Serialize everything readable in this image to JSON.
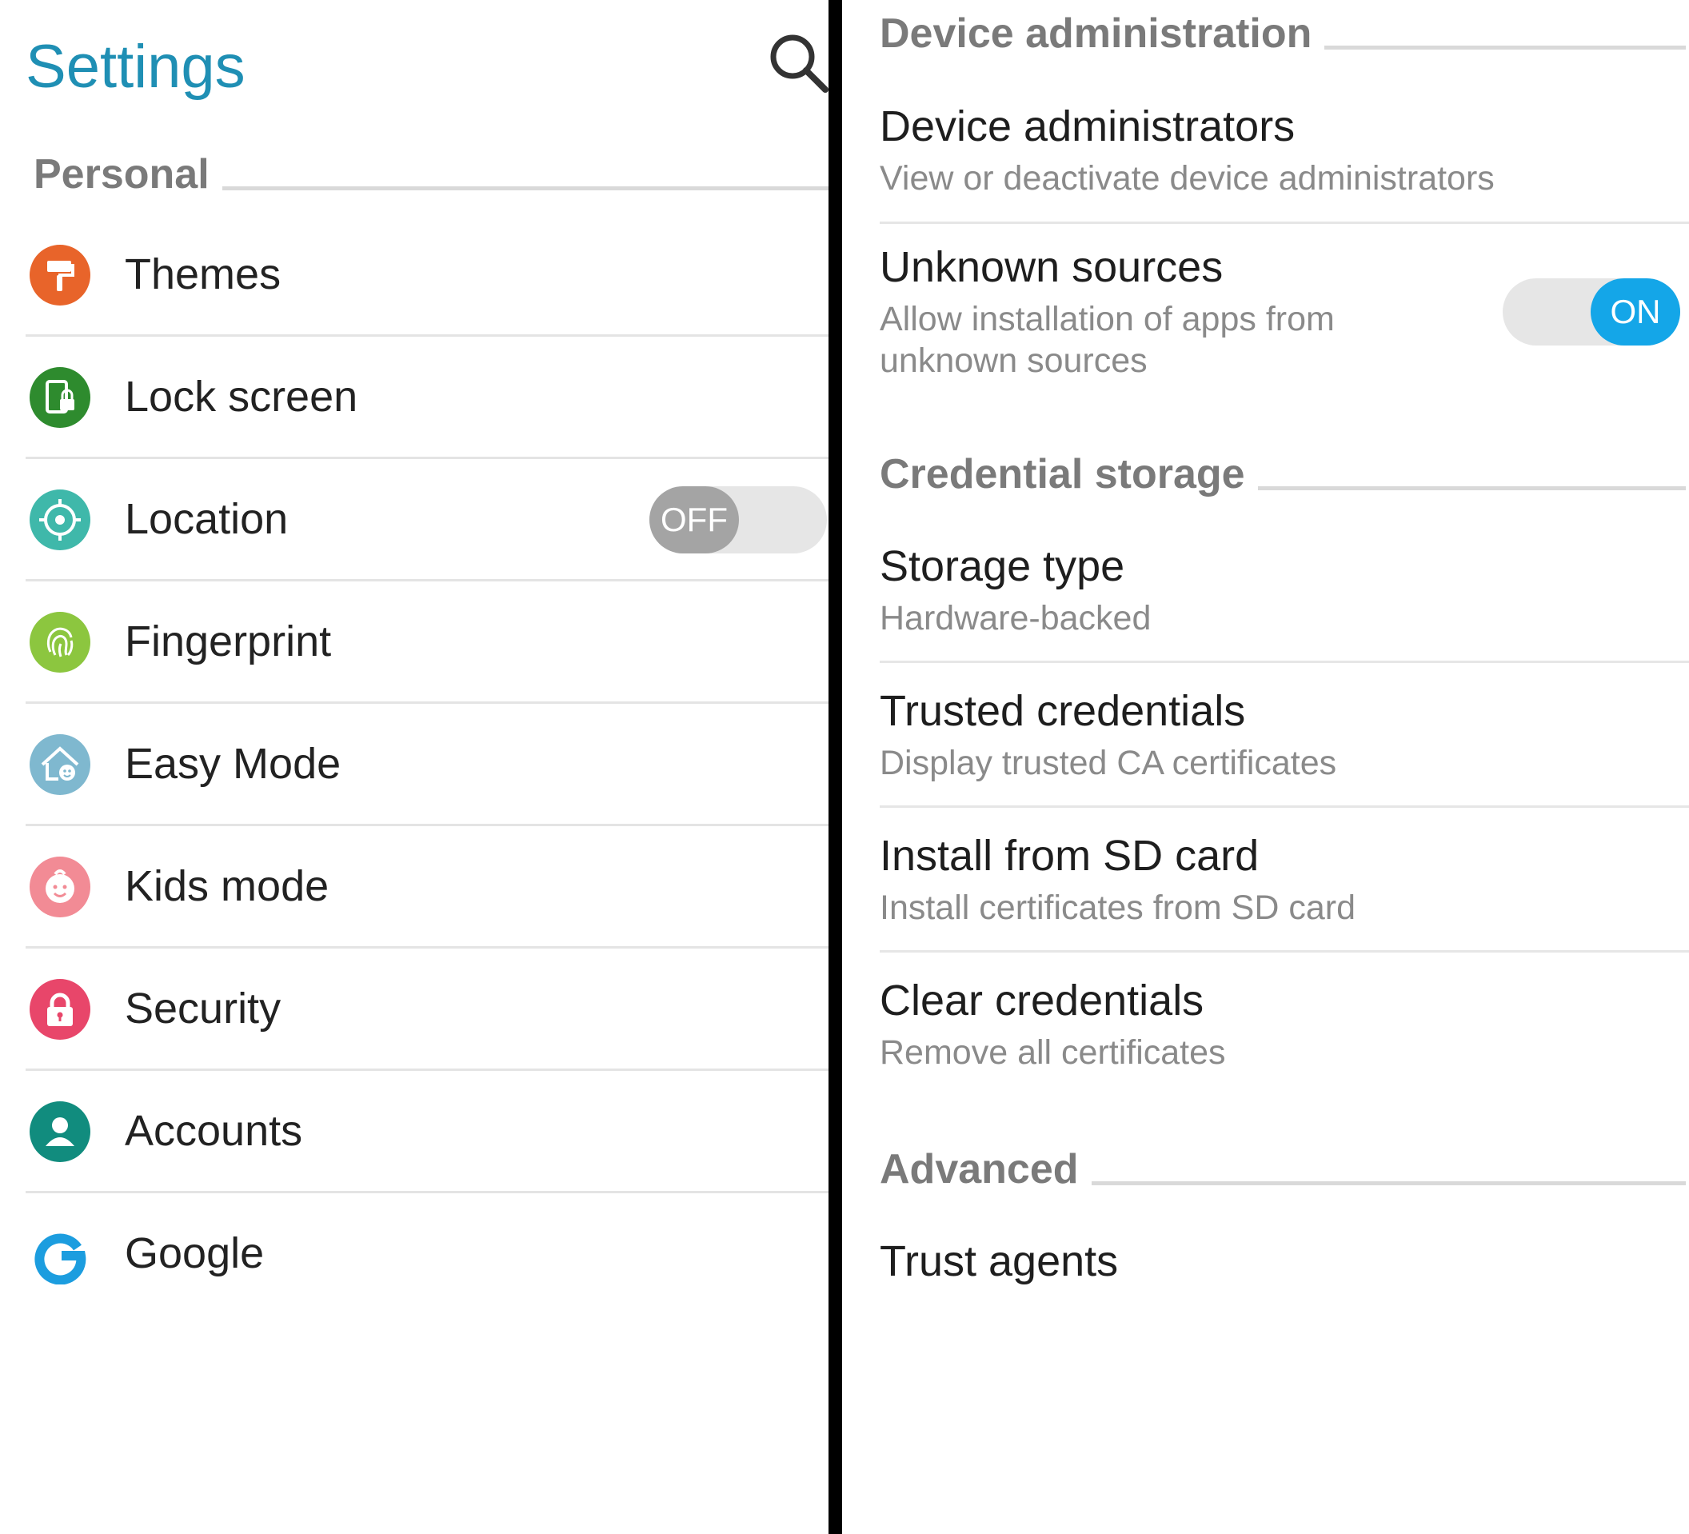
{
  "left": {
    "title": "Settings",
    "section": "Personal",
    "items": [
      {
        "label": "Themes",
        "icon": "paint-roller-icon",
        "color": "#e8642a"
      },
      {
        "label": "Lock screen",
        "icon": "lock-screen-icon",
        "color": "#2e8b2e"
      },
      {
        "label": "Location",
        "icon": "location-crosshair-icon",
        "color": "#3fb8aa",
        "toggle": "OFF"
      },
      {
        "label": "Fingerprint",
        "icon": "fingerprint-icon",
        "color": "#8cc63f"
      },
      {
        "label": "Easy Mode",
        "icon": "easy-mode-house-icon",
        "color": "#7fb8cf"
      },
      {
        "label": "Kids mode",
        "icon": "kid-face-icon",
        "color": "#f28b95"
      },
      {
        "label": "Security",
        "icon": "padlock-icon",
        "color": "#e8466a"
      },
      {
        "label": "Accounts",
        "icon": "person-icon",
        "color": "#118c7e"
      },
      {
        "label": "Google",
        "icon": "google-g-icon",
        "color": "#1c9ddf"
      }
    ]
  },
  "right": {
    "sections": [
      {
        "header": "Device administration",
        "items": [
          {
            "title": "Device administrators",
            "subtitle": "View or deactivate device administrators"
          },
          {
            "title": "Unknown sources",
            "subtitle_line1": "Allow installation of apps from",
            "subtitle_line2": "unknown sources",
            "toggle": "ON"
          }
        ]
      },
      {
        "header": "Credential storage",
        "items": [
          {
            "title": "Storage type",
            "subtitle": "Hardware-backed"
          },
          {
            "title": "Trusted credentials",
            "subtitle": "Display trusted CA certificates"
          },
          {
            "title": "Install from SD card",
            "subtitle": "Install certificates from SD card"
          },
          {
            "title": "Clear credentials",
            "subtitle": "Remove all certificates"
          }
        ]
      },
      {
        "header": "Advanced",
        "items": [
          {
            "title": "Trust agents"
          }
        ]
      }
    ]
  },
  "colors": {
    "accent": "#1f8fb4",
    "toggle_on": "#14a6e8",
    "toggle_off": "#a4a4a4"
  }
}
